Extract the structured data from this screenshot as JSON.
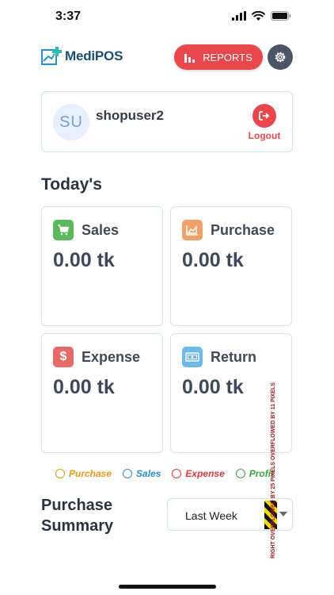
{
  "status_bar": {
    "time": "3:37"
  },
  "header": {
    "logo_text": "MediPOS",
    "reports_label": "REPORTS"
  },
  "user": {
    "initials": "SU",
    "name": "shopuser2",
    "logout_label": "Logout"
  },
  "today": {
    "title": "Today's",
    "cards": [
      {
        "label": "Sales",
        "value": "0.00 tk",
        "icon": "cart-icon",
        "color": "#5cb85c"
      },
      {
        "label": "Purchase",
        "value": "0.00 tk",
        "icon": "area-chart-icon",
        "color": "#f0a069"
      },
      {
        "label": "Expense",
        "value": "0.00 tk",
        "icon": "dollar-icon",
        "color": "#e56b6b"
      },
      {
        "label": "Return",
        "value": "0.00 tk",
        "icon": "cash-return-icon",
        "color": "#6fb8e8"
      }
    ]
  },
  "legend": [
    {
      "label": "Purchase",
      "color": "#e89a1a"
    },
    {
      "label": "Sales",
      "color": "#2f8fd8"
    },
    {
      "label": "Expense",
      "color": "#e0383d"
    },
    {
      "label": "Profit",
      "color": "#3fa340"
    }
  ],
  "summary": {
    "title": "Purchase Summary",
    "period": "Last Week"
  },
  "overflow_warning": "RIGHT OVERFLOWED BY 25 PIXELS",
  "overflow_warning_2": "OVERFLOWED BY 11 PIXELS"
}
